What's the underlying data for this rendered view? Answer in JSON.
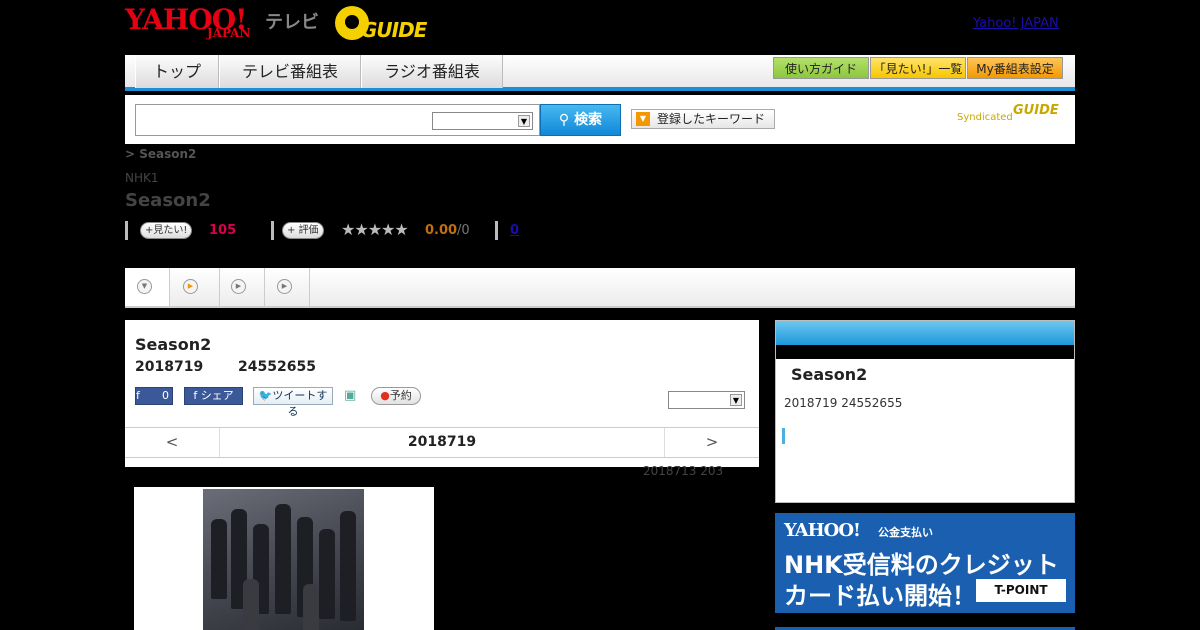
{
  "header": {
    "yahoo_logo": "YAHOO!",
    "yahoo_logo_sub": "JAPAN",
    "tv_label": "テレビ",
    "gguide_logo": "GUIDE",
    "top_link": "Yahoo! JAPAN"
  },
  "nav": {
    "tabs": [
      "トップ",
      "テレビ番組表",
      "ラジオ番組表"
    ],
    "buttons": [
      "使い方ガイド",
      "「見たい!」一覧",
      "My番組表設定"
    ],
    "button_colors": [
      "#8cc63f",
      "#f7c600",
      "#f39800"
    ]
  },
  "search": {
    "button_label": "検索",
    "keyword_button": "登録したキーワード",
    "syndicated_label": "Syndicated",
    "syndicated_logo": "GUIDE"
  },
  "program": {
    "breadcrumb": "> Season2",
    "channel": "NHK1",
    "title": "Season2",
    "mitai_label": "見たい!",
    "mitai_count": "105",
    "rating_label": "評価",
    "stars": "★★★★★",
    "score": "0.00",
    "score_count": "/0",
    "zero_link": "0"
  },
  "card": {
    "title": "Season2",
    "date": "2018719",
    "time": "24552655",
    "fb_like_count": "0",
    "fb_share": "シェア",
    "tweet": "ツイートする",
    "reserve": "予約",
    "prev": "<",
    "current_date": "2018719",
    "next": ">",
    "updated": "2018713  203"
  },
  "side": {
    "title": "Season2",
    "info": "2018719  24552655"
  },
  "ad": {
    "yahoo": "YAHOO!",
    "pay": "公金支払い",
    "line1": "NHK受信料のクレジット",
    "line2": "カード払い開始！",
    "tpoint": "T-POINT"
  }
}
